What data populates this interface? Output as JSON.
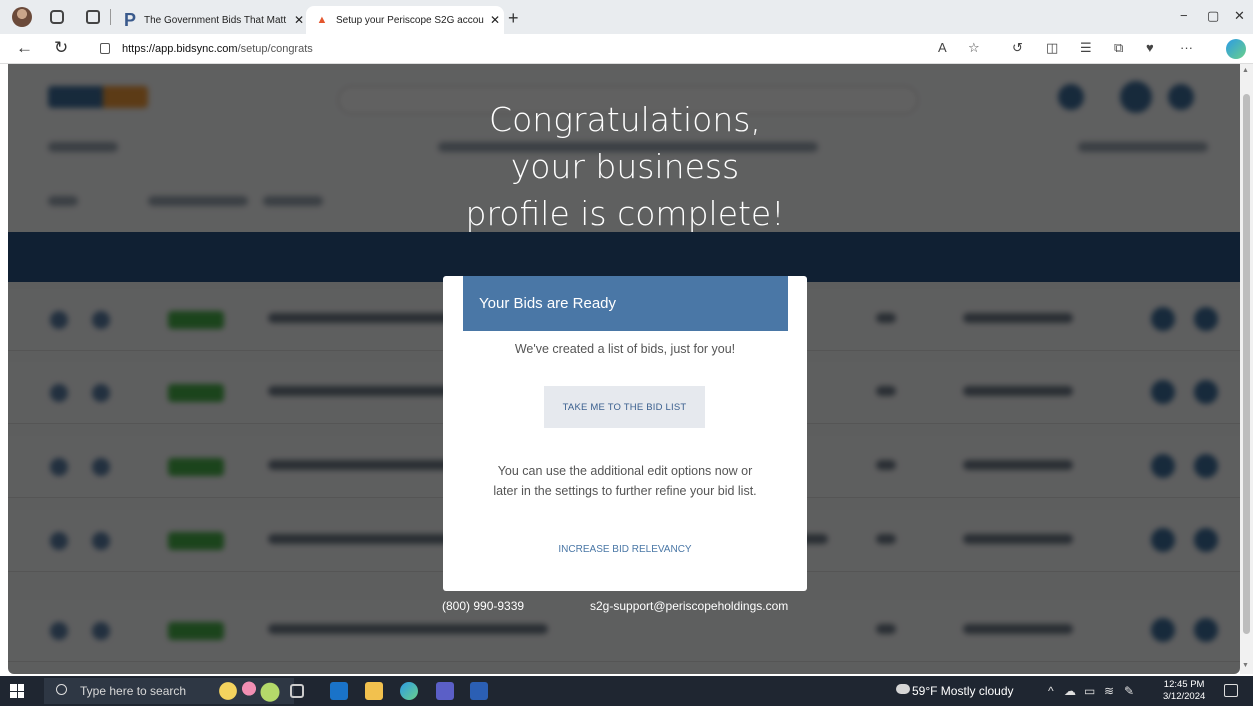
{
  "browser": {
    "tabs": [
      {
        "title": "The Government Bids That Matt",
        "favicon": "periscope-p-icon"
      },
      {
        "title": "Setup your Periscope S2G accou",
        "favicon": "bidsync-icon"
      }
    ],
    "new_tab": "+",
    "url_host": "https://app.bidsync.com",
    "url_path": "/setup/congrats",
    "window_controls": [
      "−",
      "▢",
      "✕"
    ]
  },
  "page": {
    "congrats_line1": "Congratulations,",
    "congrats_line2": "your business",
    "congrats_line3": "profile is complete!",
    "modal": {
      "header": "Your Bids are Ready",
      "subtitle": "We've created a list of bids, just for you!",
      "primary_button": "TAKE ME TO THE BID LIST",
      "info_line1": "You can use the additional edit options now or",
      "info_line2": "later in the settings to further refine your bid list.",
      "secondary_link": "INCREASE BID RELEVANCY"
    },
    "contact_phone": "(800) 990-9339",
    "contact_email": "s2g-support@periscopeholdings.com"
  },
  "taskbar": {
    "search_placeholder": "Type here to search",
    "weather": "59°F  Mostly cloudy",
    "time": "12:45 PM",
    "date": "3/12/2024"
  },
  "colors": {
    "modal_header": "#4a77a6",
    "table_header": "#2c5587",
    "status_pill": "#49b24a"
  }
}
